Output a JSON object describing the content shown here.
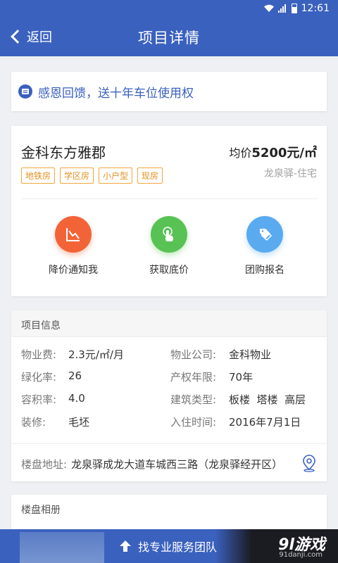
{
  "status_bar": {
    "time": "12:61"
  },
  "header": {
    "back_label": "返回",
    "title": "项目详情"
  },
  "promo": {
    "text": "感恩回馈，送十年车位使用权"
  },
  "project": {
    "name": "金科东方雅郡",
    "price_prefix": "均价",
    "price_value": "5200元/㎡",
    "location": "龙泉驿-住宅",
    "tags": [
      "地铁房",
      "学区房",
      "小户型",
      "现房"
    ]
  },
  "actions": [
    {
      "label": "降价通知我",
      "icon": "price-drop-chart-icon",
      "color": "#f26437"
    },
    {
      "label": "获取底价",
      "icon": "touch-hand-icon",
      "color": "#58c254"
    },
    {
      "label": "团购报名",
      "icon": "group-tags-icon",
      "color": "#5aaaf0"
    }
  ],
  "info": {
    "header": "项目信息",
    "rows": [
      {
        "k1": "物业费:",
        "v1": "2.3元/㎡/月",
        "k2": "物业公司:",
        "v2": "金科物业"
      },
      {
        "k1": "绿化率:",
        "v1": "26",
        "k2": "产权年限:",
        "v2": "70年"
      },
      {
        "k1": "容积率:",
        "v1": "4.0",
        "k2": "建筑类型:",
        "v2": "板楼  塔楼  高层"
      },
      {
        "k1": "装修:",
        "v1": "毛坯",
        "k2": "入住时间:",
        "v2": "2016年7月1日"
      }
    ],
    "address_label": "楼盘地址:",
    "address_value": "龙泉驿成龙大道车城西三路（龙泉驿经开区）"
  },
  "album": {
    "header": "楼盘相册"
  },
  "bottom_bar": {
    "button_label": "找专业服务团队"
  },
  "watermark": {
    "logo": "9l游戏",
    "url": "91danji.com"
  },
  "colors": {
    "brand": "#3b61bf",
    "tag": "#f2a641"
  }
}
